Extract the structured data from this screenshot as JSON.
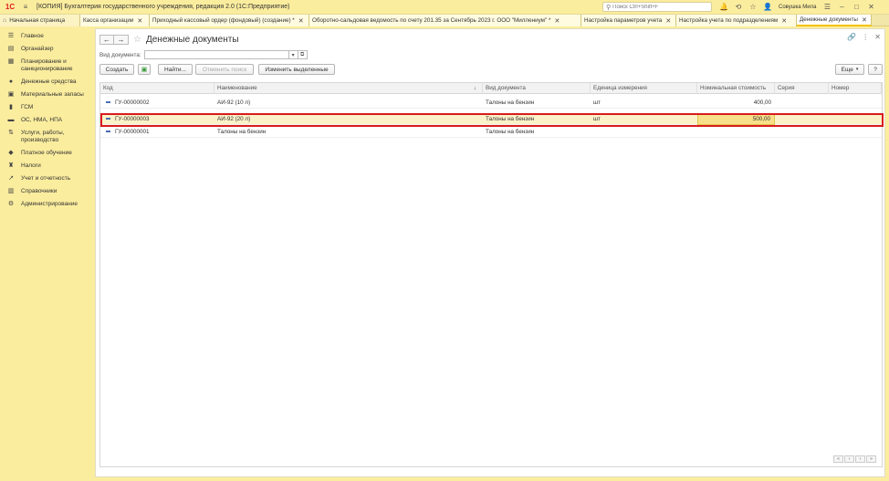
{
  "titlebar": {
    "logo": "1С",
    "app_title": "[КОПИЯ] Бухгалтерия государственного учреждения, редакция 2.0  (1С:Предприятие)",
    "search_placeholder": "Поиск Ctrl+Shift+F",
    "user_name": "Совушка Мила"
  },
  "tabs": [
    {
      "label": "Начальная страница",
      "closable": false
    },
    {
      "label": "Касса организации",
      "closable": true
    },
    {
      "label": "Приходный кассовый ордер (фондовый) (создание) *",
      "closable": true
    },
    {
      "label": "Оборотно-сальдовая ведомость по счету 201.35 за Сентябрь 2023 г. ООО \"Миллениум\" *",
      "closable": true
    },
    {
      "label": "Настройка параметров учета",
      "closable": true
    },
    {
      "label": "Настройка учета по подразделениям",
      "closable": true
    },
    {
      "label": "Денежные документы",
      "closable": true,
      "active": true
    }
  ],
  "sidebar": {
    "items": [
      {
        "label": "Главное",
        "icon": "menu-icon"
      },
      {
        "label": "Органайзер",
        "icon": "organizer-icon"
      },
      {
        "label": "Планирование и санкционирование",
        "icon": "planning-icon"
      },
      {
        "label": "Денежные средства",
        "icon": "money-icon"
      },
      {
        "label": "Материальные запасы",
        "icon": "materials-icon"
      },
      {
        "label": "ГСМ",
        "icon": "fuel-icon"
      },
      {
        "label": "ОС, НМА, НПА",
        "icon": "assets-icon"
      },
      {
        "label": "Услуги, работы, производство",
        "icon": "services-icon"
      },
      {
        "label": "Платное обучение",
        "icon": "education-icon"
      },
      {
        "label": "Налоги",
        "icon": "taxes-icon"
      },
      {
        "label": "Учет и отчетность",
        "icon": "reports-icon"
      },
      {
        "label": "Справочники",
        "icon": "directories-icon"
      },
      {
        "label": "Администрирование",
        "icon": "admin-icon"
      }
    ]
  },
  "main": {
    "title": "Денежные документы",
    "filter": {
      "label": "Вид документа:",
      "value": ""
    },
    "toolbar": {
      "create": "Создать",
      "find": "Найти...",
      "cancel_search": "Отменить поиск",
      "edit_selected": "Изменить выделенные",
      "more": "Еще",
      "help": "?"
    },
    "table": {
      "columns": [
        "Код",
        "Наименование",
        "Вид документа",
        "Единица измерения",
        "Номинальная стоимость",
        "Серия",
        "Номер"
      ],
      "sort_indicator": "↓",
      "rows": [
        {
          "code": "ГУ-00000002",
          "name": "АИ-92 (10 л)",
          "doc_type": "Талоны на бензин",
          "unit": "шт",
          "nominal": "400,00",
          "series": "",
          "number": "",
          "selected": false
        },
        {
          "code": "ГУ-00000003",
          "name": "АИ-92 (20 л)",
          "doc_type": "Талоны на бензин",
          "unit": "шт",
          "nominal": "500,00",
          "series": "",
          "number": "",
          "selected": true
        },
        {
          "code": "ГУ-00000001",
          "name": "Талоны на бензин",
          "doc_type": "Талоны на бензин",
          "unit": "",
          "nominal": "",
          "series": "",
          "number": "",
          "selected": false
        }
      ]
    }
  },
  "colors": {
    "accent": "#fbed9e",
    "highlight_border": "#d91c1c",
    "selected_row": "#fbf2c9"
  }
}
